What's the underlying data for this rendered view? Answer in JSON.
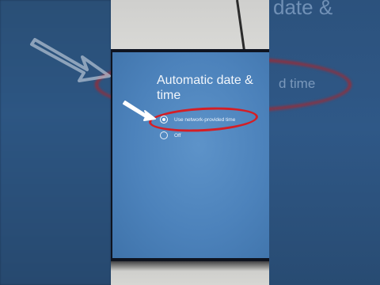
{
  "background": {
    "blurred_title": "date &",
    "blurred_option": "d time"
  },
  "screen": {
    "title": "Automatic date & time",
    "options": [
      {
        "label": "Use network-provided time",
        "selected": true
      },
      {
        "label": "Off",
        "selected": false
      }
    ]
  },
  "annotations": {
    "highlight_color": "#d41e25",
    "arrow_color": "#ffffff"
  }
}
